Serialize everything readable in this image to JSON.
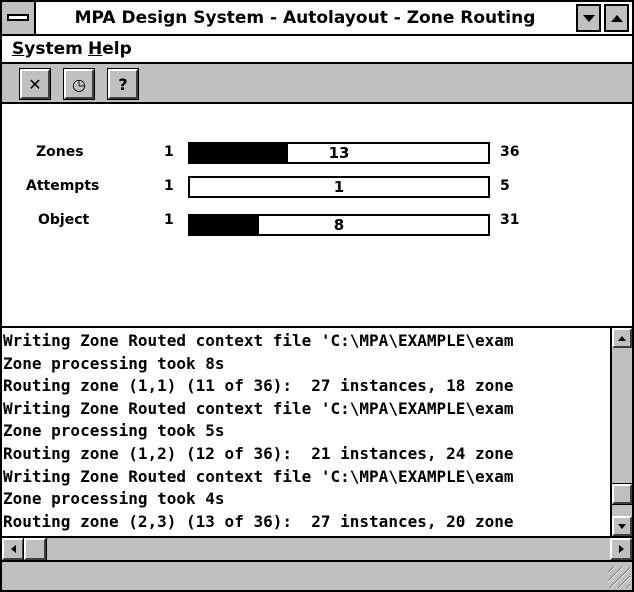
{
  "window": {
    "title": "MPA Design System - Autolayout - Zone Routing",
    "icons": {
      "system_menu": "system-menu-box-icon",
      "minimize": "triangle-down-icon",
      "maximize": "triangle-up-icon"
    }
  },
  "menu": {
    "items": [
      {
        "label": "System",
        "mnemonic": "S"
      },
      {
        "label": "Help",
        "mnemonic": "H"
      }
    ]
  },
  "toolbar": {
    "buttons": [
      {
        "icon": "cancel-x-icon",
        "glyph": "✕"
      },
      {
        "icon": "clock-icon",
        "glyph": "◷"
      },
      {
        "icon": "question-help-icon",
        "glyph": "?"
      }
    ]
  },
  "progress": {
    "rows": [
      {
        "label": "Zones",
        "min": "1",
        "value": "13",
        "max": "36",
        "fraction": 0.33
      },
      {
        "label": "Attempts",
        "min": "1",
        "value": "1",
        "max": "5",
        "fraction": 0.0
      },
      {
        "label": "Object",
        "min": "1",
        "value": "8",
        "max": "31",
        "fraction": 0.23
      }
    ]
  },
  "log": {
    "lines": [
      "Writing Zone Routed context file 'C:\\MPA\\EXAMPLE\\exam",
      "Zone processing took 8s",
      "Routing zone (1,1) (11 of 36):  27 instances, 18 zone",
      "Writing Zone Routed context file 'C:\\MPA\\EXAMPLE\\exam",
      "Zone processing took 5s",
      "Routing zone (1,2) (12 of 36):  21 instances, 24 zone",
      "Writing Zone Routed context file 'C:\\MPA\\EXAMPLE\\exam",
      "Zone processing took 4s",
      "Routing zone (2,3) (13 of 36):  27 instances, 20 zone"
    ],
    "vertical_scroll_position": 0.92,
    "horizontal_scroll_position": 0.0
  },
  "colors": {
    "face": "#c0c0c0",
    "text": "#000000",
    "background": "#ffffff"
  }
}
